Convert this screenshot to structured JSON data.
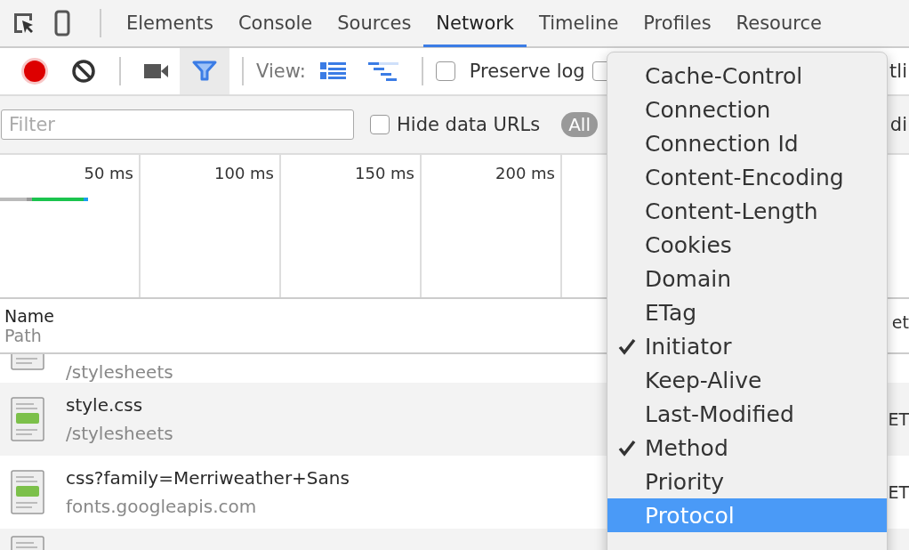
{
  "tabs": [
    {
      "label": "Elements",
      "selected": false
    },
    {
      "label": "Console",
      "selected": false
    },
    {
      "label": "Sources",
      "selected": false
    },
    {
      "label": "Network",
      "selected": true
    },
    {
      "label": "Timeline",
      "selected": false
    },
    {
      "label": "Profiles",
      "selected": false
    },
    {
      "label": "Resource",
      "selected": false
    }
  ],
  "toolbar": {
    "recording": true,
    "filter_on": true,
    "view_label": "View:",
    "preserve_log": {
      "label": "Preserve log",
      "checked": false
    },
    "checkbox_2": {
      "checked": false
    },
    "text_right": "tli"
  },
  "filter_bar": {
    "placeholder": "Filter",
    "hide_data_urls": {
      "label": "Hide data URLs",
      "checked": false
    },
    "types": [
      {
        "label": "All",
        "selected": true
      }
    ],
    "text_right": "di"
  },
  "timeline": {
    "ticks": [
      "50 ms",
      "100 ms",
      "150 ms",
      "200 ms"
    ]
  },
  "table": {
    "columns": [
      {
        "name": "Name",
        "sub": "Path"
      },
      {
        "name": "et"
      }
    ],
    "rows": [
      {
        "name": "",
        "path": "/stylesheets",
        "method": ""
      },
      {
        "name": "style.css",
        "path": "/stylesheets",
        "method": "ET"
      },
      {
        "name": "css?family=Merriweather+Sans",
        "path": "fonts.googleapis.com",
        "method": "ET"
      },
      {
        "name": "",
        "path": "",
        "method": ""
      }
    ]
  },
  "menu": [
    {
      "label": "Cache-Control",
      "checked": false,
      "selected": false
    },
    {
      "label": "Connection",
      "checked": false,
      "selected": false
    },
    {
      "label": "Connection Id",
      "checked": false,
      "selected": false
    },
    {
      "label": "Content-Encoding",
      "checked": false,
      "selected": false
    },
    {
      "label": "Content-Length",
      "checked": false,
      "selected": false
    },
    {
      "label": "Cookies",
      "checked": false,
      "selected": false
    },
    {
      "label": "Domain",
      "checked": false,
      "selected": false
    },
    {
      "label": "ETag",
      "checked": false,
      "selected": false
    },
    {
      "label": "Initiator",
      "checked": true,
      "selected": false
    },
    {
      "label": "Keep-Alive",
      "checked": false,
      "selected": false
    },
    {
      "label": "Last-Modified",
      "checked": false,
      "selected": false
    },
    {
      "label": "Method",
      "checked": true,
      "selected": false
    },
    {
      "label": "Priority",
      "checked": false,
      "selected": false
    },
    {
      "label": "Protocol",
      "checked": false,
      "selected": true
    }
  ]
}
